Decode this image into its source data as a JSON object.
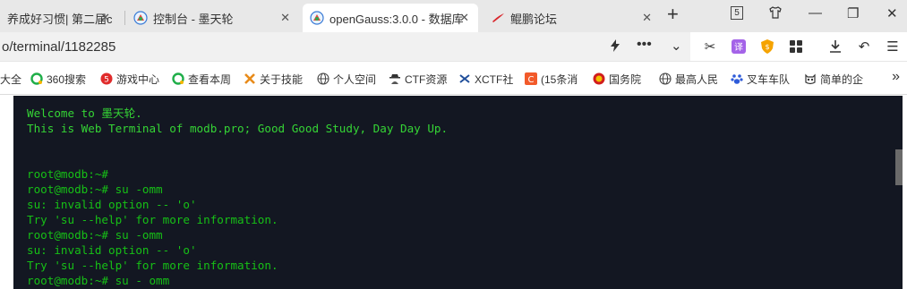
{
  "tabs": [
    {
      "title": "养成好习惯| 第二届c",
      "favicon": "none",
      "active": false
    },
    {
      "title": "控制台 - 墨天轮",
      "favicon": "modb-icon",
      "active": false
    },
    {
      "title": "openGauss:3.0.0 - 数据库",
      "favicon": "opengauss-icon",
      "active": true
    },
    {
      "title": "鲲鹏论坛",
      "favicon": "kunpeng-icon",
      "active": false
    }
  ],
  "tab_count_badge": "5",
  "address": {
    "url": "o/terminal/1182285"
  },
  "bookmarks": [
    {
      "label": "大全",
      "icon": "none"
    },
    {
      "label": "360搜索",
      "icon": "360-search-icon"
    },
    {
      "label": "游戏中心",
      "icon": "game-center-icon"
    },
    {
      "label": "查看本周",
      "icon": "360-search-icon"
    },
    {
      "label": "关于技能",
      "icon": "x-brand-icon"
    },
    {
      "label": "个人空间",
      "icon": "globe-icon"
    },
    {
      "label": "CTF资源",
      "icon": "spy-icon"
    },
    {
      "label": "XCTF社",
      "icon": "xctf-icon"
    },
    {
      "label": "(15条消",
      "icon": "c-brand-icon"
    },
    {
      "label": "国务院",
      "icon": "emblem-icon"
    },
    {
      "label": "最高人民",
      "icon": "globe-icon"
    },
    {
      "label": "叉车车队",
      "icon": "baidu-paw-icon"
    },
    {
      "label": "简单的企",
      "icon": "owl-icon"
    }
  ],
  "terminal": {
    "lines": [
      {
        "text": "Welcome to 墨天轮.",
        "kind": "welcome"
      },
      {
        "text": "This is Web Terminal of modb.pro; Good Good Study, Day Day Up.",
        "kind": "welcome"
      },
      {
        "text": "",
        "kind": "out"
      },
      {
        "text": "",
        "kind": "out"
      },
      {
        "text": "root@modb:~#",
        "kind": "out"
      },
      {
        "text": "root@modb:~# su -omm",
        "kind": "out"
      },
      {
        "text": "su: invalid option -- 'o'",
        "kind": "out"
      },
      {
        "text": "Try 'su --help' for more information.",
        "kind": "out"
      },
      {
        "text": "root@modb:~# su -omm",
        "kind": "out"
      },
      {
        "text": "su: invalid option -- 'o'",
        "kind": "out"
      },
      {
        "text": "Try 'su --help' for more information.",
        "kind": "out"
      },
      {
        "text": "root@modb:~# su - omm",
        "kind": "out"
      }
    ]
  },
  "colors": {
    "terminal_bg": "#131722",
    "terminal_fg": "#16c016"
  }
}
